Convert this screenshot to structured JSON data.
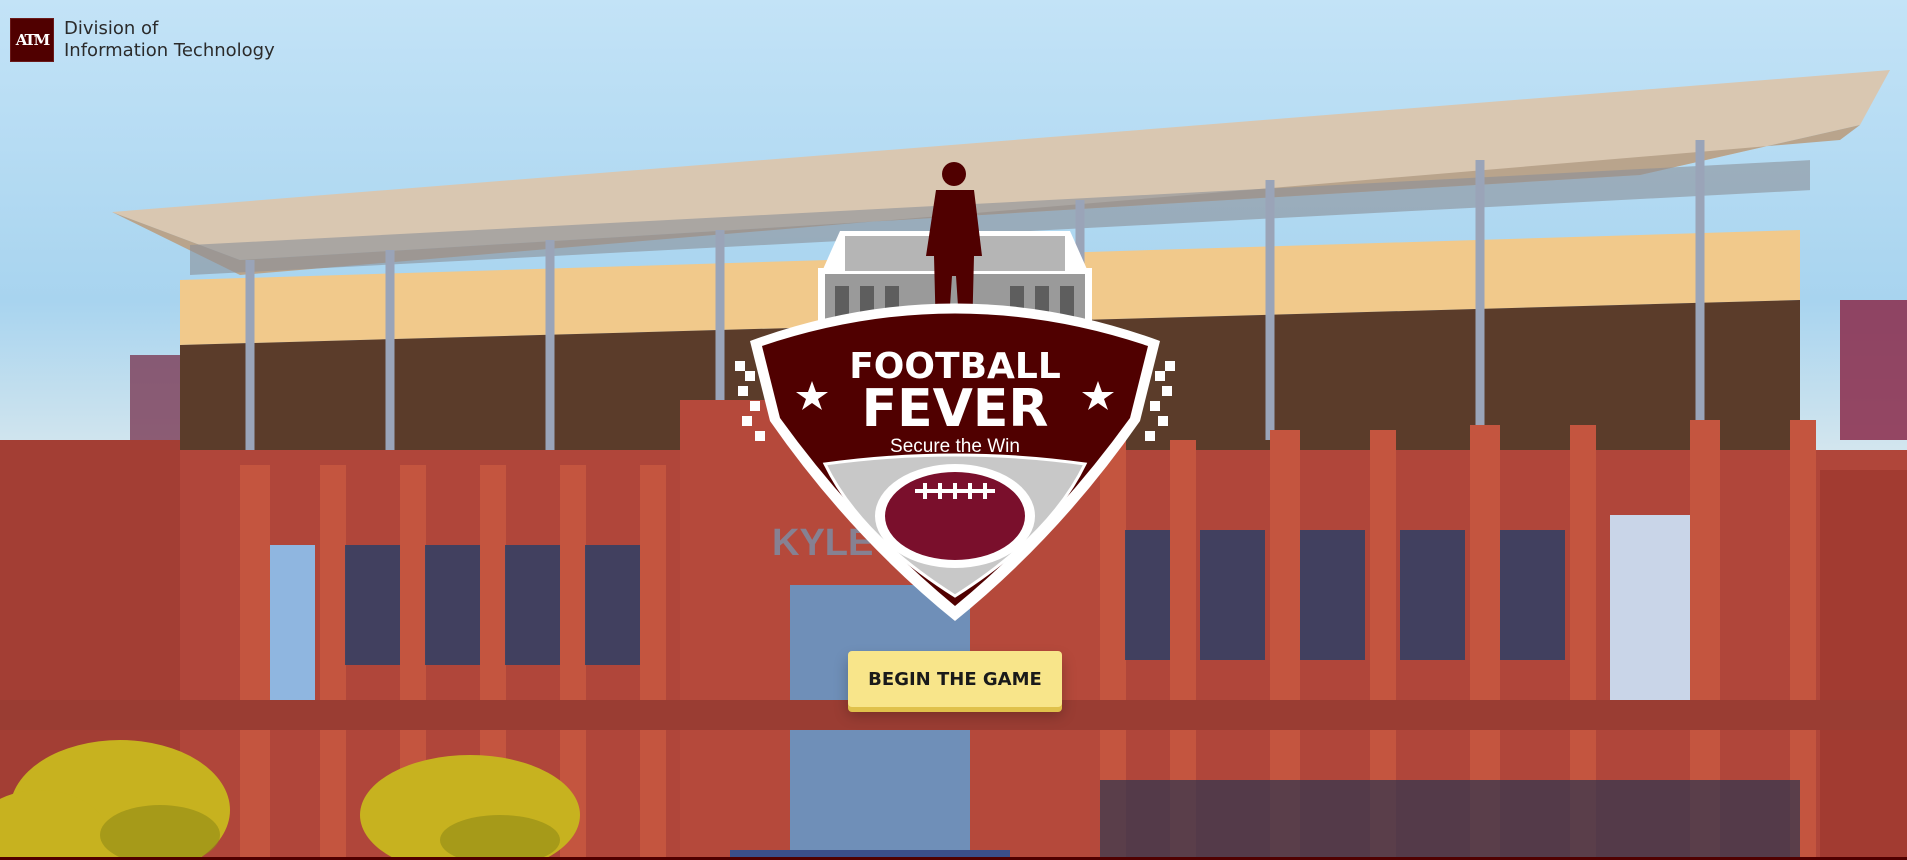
{
  "header": {
    "logo_text": "ATM",
    "org_line1": "Division of",
    "org_line2": "Information Technology"
  },
  "badge": {
    "title_line1": "FOOTBALL",
    "title_line2": "FEVER",
    "tagline": "Secure the Win"
  },
  "stadium_sign": "KYLE",
  "action": {
    "begin_label": "BEGIN THE GAME"
  },
  "colors": {
    "maroon": "#500000",
    "button_yellow": "#f8e58a",
    "brick": "#b0463a"
  }
}
